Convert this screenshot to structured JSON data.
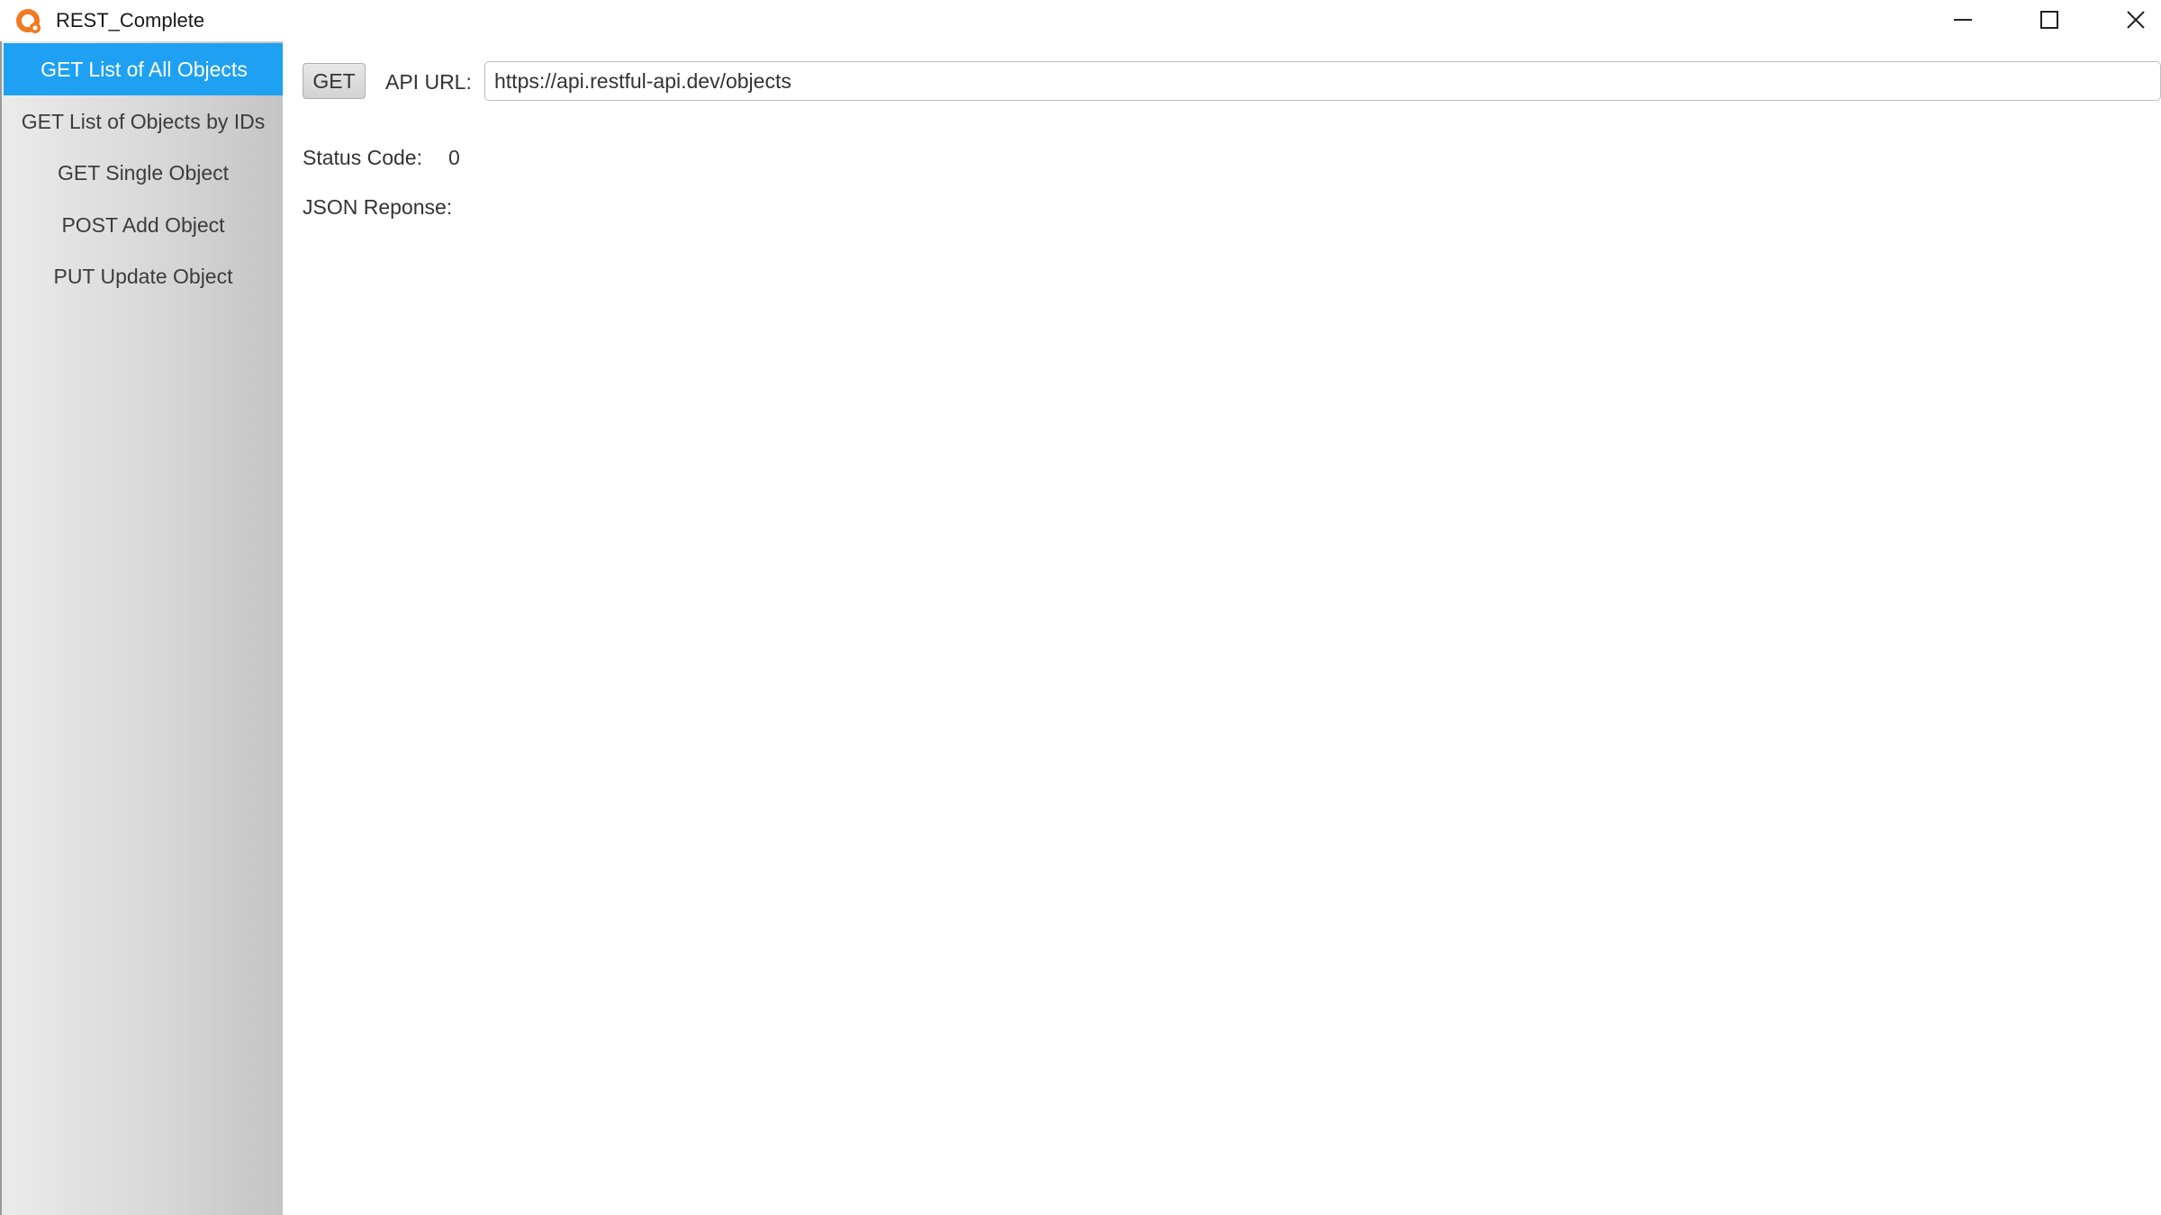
{
  "window": {
    "title": "REST_Complete",
    "app_icon": "orange-app-icon",
    "controls": {
      "minimize_icon": "minimize-icon",
      "maximize_icon": "maximize-icon",
      "close_icon": "close-icon"
    }
  },
  "sidebar": {
    "items": [
      {
        "label": "GET List of All Objects",
        "active": true
      },
      {
        "label": "GET List of Objects by IDs",
        "active": false
      },
      {
        "label": "GET Single Object",
        "active": false
      },
      {
        "label": "POST Add Object",
        "active": false
      },
      {
        "label": "PUT Update Object",
        "active": false
      }
    ]
  },
  "main": {
    "method_button": "GET",
    "url_label": "API URL:",
    "url_value": "https://api.restful-api.dev/objects",
    "status_label": "Status Code:",
    "status_value": "0",
    "json_label": "JSON Reponse:",
    "json_body": ""
  },
  "colors": {
    "accent": "#1ea1f2",
    "app_icon": "#f07a22"
  }
}
